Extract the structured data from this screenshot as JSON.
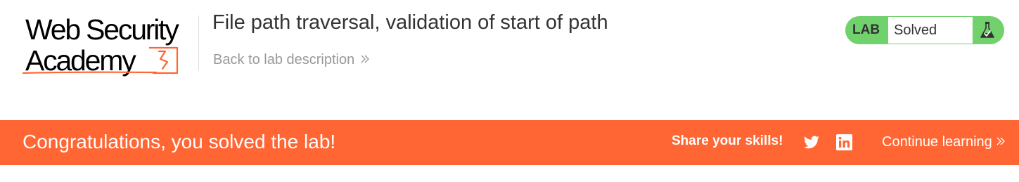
{
  "logo": {
    "line1": "Web Security",
    "line2": "Academy"
  },
  "lab": {
    "title": "File path traversal, validation of start of path",
    "back_link": "Back to lab description",
    "badge_label": "LAB",
    "status": "Solved"
  },
  "banner": {
    "message": "Congratulations, you solved the lab!",
    "share_label": "Share your skills!",
    "continue_label": "Continue learning"
  },
  "icons": {
    "back": "double-chevron-right-icon",
    "flask": "flask-icon",
    "twitter": "twitter-icon",
    "linkedin": "linkedin-icon",
    "continue": "double-chevron-right-icon"
  },
  "colors": {
    "accent_orange": "#ff6633",
    "status_green": "#70d16d",
    "title_text": "#333333",
    "muted_text": "#999999"
  }
}
